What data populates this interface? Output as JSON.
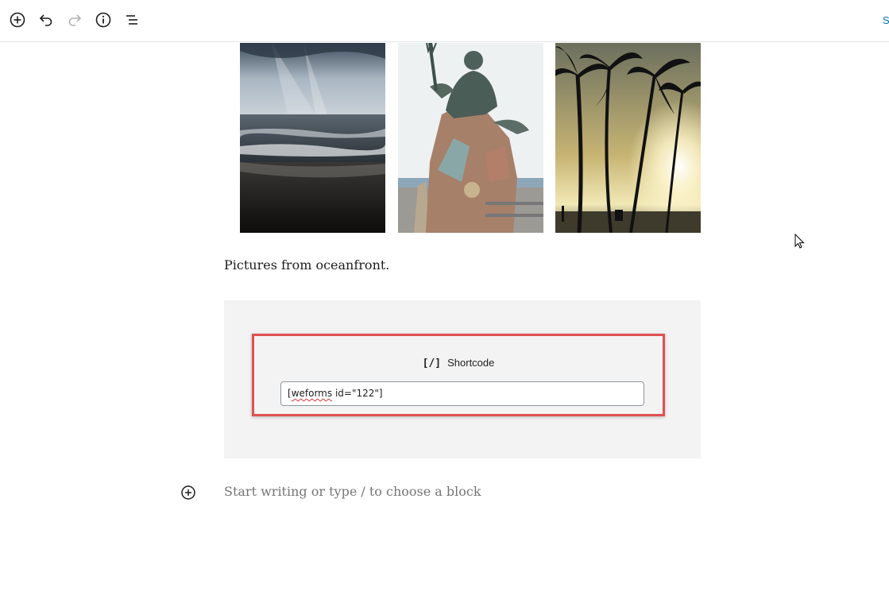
{
  "toolbar": {
    "buttons": [
      {
        "name": "add-block",
        "icon": "plus-circle-icon"
      },
      {
        "name": "undo",
        "icon": "undo-icon"
      },
      {
        "name": "redo",
        "icon": "redo-icon"
      },
      {
        "name": "info",
        "icon": "info-icon"
      },
      {
        "name": "block-navigation",
        "icon": "list-icon"
      }
    ],
    "right_link": "S"
  },
  "gallery": {
    "images": [
      {
        "subject": "ocean-sunrays"
      },
      {
        "subject": "neptune-statue"
      },
      {
        "subject": "palm-trees-sunset"
      }
    ]
  },
  "caption": "Pictures from oceanfront.",
  "shortcode": {
    "icon": "[/]",
    "title": "Shortcode",
    "value_prefix": "[",
    "value_word": "weforms",
    "value_suffix": " id=\"122\"]"
  },
  "editor": {
    "placeholder": "Start writing or type / to choose a block"
  },
  "colors": {
    "highlight": "#e05151",
    "link": "#0073aa",
    "block_bg": "#f3f3f3"
  }
}
